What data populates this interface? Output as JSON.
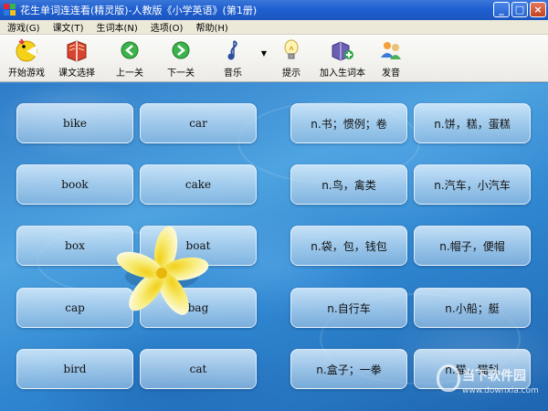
{
  "window": {
    "title": "花生单词连连看(精灵版)-人教版《小学英语》(第1册)",
    "controls": {
      "minimize": "_",
      "maximize": "□",
      "close": "×"
    }
  },
  "menu": [
    {
      "label": "游戏(G)"
    },
    {
      "label": "课文(T)"
    },
    {
      "label": "生词本(N)"
    },
    {
      "label": "选项(O)"
    },
    {
      "label": "帮助(H)"
    }
  ],
  "toolbar": [
    {
      "label": "开始游戏",
      "icon": "smiley-pac-icon"
    },
    {
      "label": "课文选择",
      "icon": "book-icon"
    },
    {
      "label": "上一关",
      "icon": "arrow-left-icon"
    },
    {
      "label": "下一关",
      "icon": "arrow-right-icon"
    },
    {
      "label": "音乐",
      "icon": "music-note-icon"
    },
    {
      "label": "提示",
      "icon": "lightbulb-icon"
    },
    {
      "label": "加入生词本",
      "icon": "add-book-icon"
    },
    {
      "label": "发音",
      "icon": "speaker-people-icon"
    }
  ],
  "cards": [
    {
      "text": "bike"
    },
    {
      "text": "car"
    },
    {
      "text": "n.书；惯例；卷"
    },
    {
      "text": "n.饼，糕，蛋糕"
    },
    {
      "text": "book"
    },
    {
      "text": "cake"
    },
    {
      "text": "n.鸟，禽类"
    },
    {
      "text": "n.汽车，小汽车"
    },
    {
      "text": "box"
    },
    {
      "text": "boat"
    },
    {
      "text": "n.袋，包，钱包"
    },
    {
      "text": "n.帽子，便帽"
    },
    {
      "text": "cap"
    },
    {
      "text": "bag"
    },
    {
      "text": "n.自行车"
    },
    {
      "text": "n.小船；艇"
    },
    {
      "text": "bird"
    },
    {
      "text": "cat"
    },
    {
      "text": "n.盒子；一拳"
    },
    {
      "text": "n.猫，猫科"
    }
  ],
  "watermark": {
    "main": "当下软件园",
    "sub": "www.downxia.com"
  },
  "colors": {
    "titlebar": "#1f5fd0",
    "menubar": "#ece9d8",
    "water": "#2e7cc8"
  }
}
